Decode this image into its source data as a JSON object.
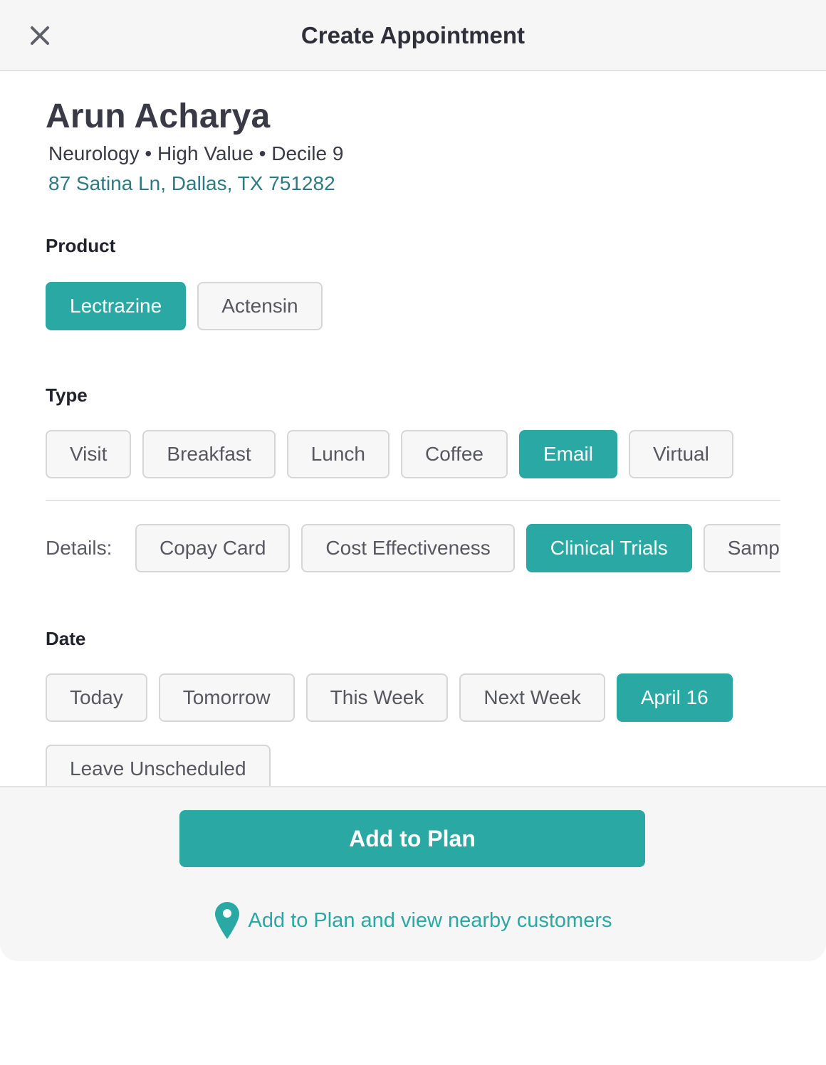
{
  "header": {
    "title": "Create Appointment",
    "close_icon": "close-icon"
  },
  "customer": {
    "name": "Arun Acharya",
    "meta": "Neurology • High Value • Decile 9",
    "address": "87 Satina Ln, Dallas, TX 751282"
  },
  "product": {
    "label": "Product",
    "options": [
      "Lectrazine",
      "Actensin"
    ],
    "selected": "Lectrazine"
  },
  "type": {
    "label": "Type",
    "options": [
      "Visit",
      "Breakfast",
      "Lunch",
      "Coffee",
      "Email",
      "Virtual"
    ],
    "selected": "Email"
  },
  "details": {
    "label": "Details:",
    "options": [
      "Copay Card",
      "Cost Effectiveness",
      "Clinical Trials",
      "Samples"
    ],
    "selected": "Clinical Trials"
  },
  "date": {
    "label": "Date",
    "options": [
      "Today",
      "Tomorrow",
      "This Week",
      "Next Week",
      "April 16"
    ],
    "selected": "April 16",
    "unscheduled_label": "Leave Unscheduled"
  },
  "footer": {
    "primary_label": "Add to Plan",
    "secondary_label": "Add to Plan and view nearby customers",
    "secondary_icon": "map-pin-icon"
  },
  "colors": {
    "accent": "#2aa8a3",
    "address_link": "#2d7b80",
    "chip_border": "#d6d6d6",
    "chip_background": "#f7f7f7"
  }
}
